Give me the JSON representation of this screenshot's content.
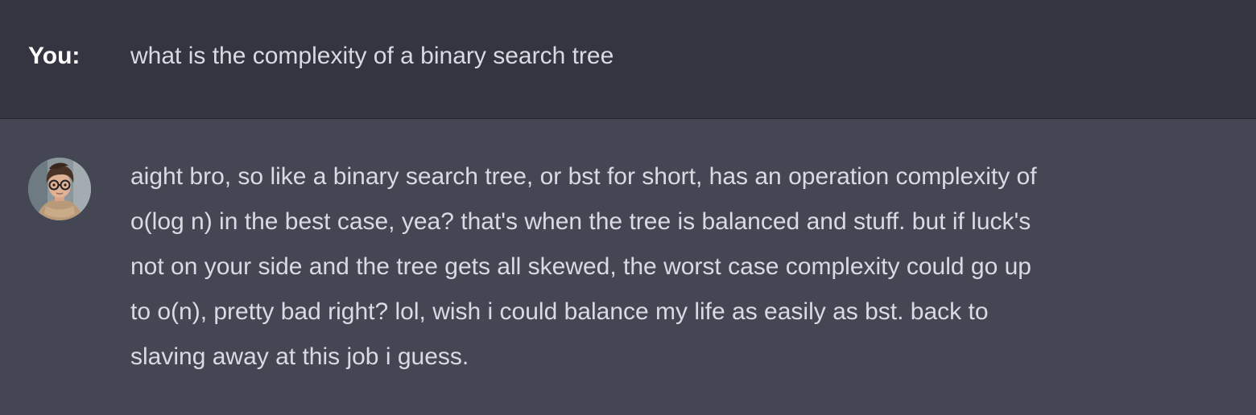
{
  "messages": {
    "user": {
      "speaker_label": "You:",
      "text": "what is the complexity of a binary search tree"
    },
    "assistant": {
      "avatar_icon": "avatar-icon",
      "lines": [
        "aight bro, so like a binary search tree, or bst for short, has an operation complexity of",
        "o(log n) in the best case, yea? that's when the tree is balanced and stuff. but if luck's",
        "not on your side and the tree gets all skewed, the worst case complexity could go up",
        "to o(n), pretty bad right? lol, wish i could balance my life as easily as bst. back to",
        "slaving away at this job i guess."
      ]
    }
  },
  "colors": {
    "user_row_bg": "#343541",
    "assistant_row_bg": "#444654",
    "text": "#d9dae2",
    "speaker": "#ffffff"
  }
}
